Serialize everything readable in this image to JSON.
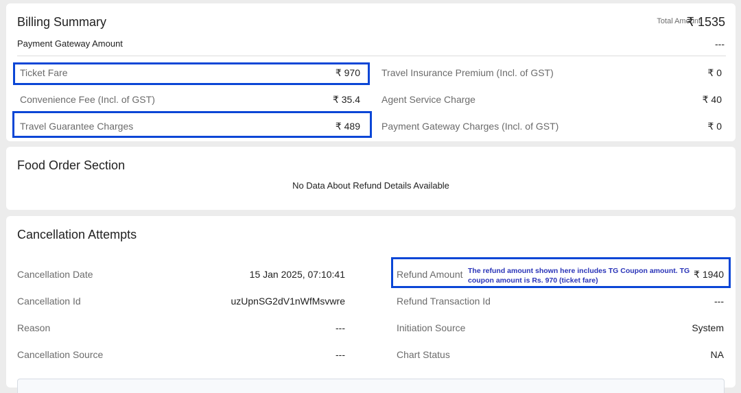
{
  "billing": {
    "title": "Billing Summary",
    "total_label": "Total Amount",
    "total_value": "₹ 1535",
    "gateway_label": "Payment Gateway Amount",
    "gateway_value": "---",
    "rows_left": [
      {
        "label": "Ticket Fare",
        "value": "₹ 970"
      },
      {
        "label": "Convenience Fee (Incl. of GST)",
        "value": "₹ 35.4"
      },
      {
        "label": "Travel Guarantee Charges",
        "value": "₹ 489"
      }
    ],
    "rows_right": [
      {
        "label": "Travel Insurance Premium (Incl. of GST)",
        "value": "₹ 0"
      },
      {
        "label": "Agent Service Charge",
        "value": "₹ 40"
      },
      {
        "label": "Payment Gateway Charges (Incl. of GST)",
        "value": "₹ 0"
      }
    ]
  },
  "food": {
    "title": "Food Order Section",
    "empty_message": "No Data About Refund Details Available"
  },
  "cancellation": {
    "title": "Cancellation Attempts",
    "rows_left": [
      {
        "label": "Cancellation Date",
        "value": "15 Jan 2025, 07:10:41"
      },
      {
        "label": "Cancellation Id",
        "value": "uzUpnSG2dV1nWfMsvwre"
      },
      {
        "label": "Reason",
        "value": "---"
      },
      {
        "label": "Cancellation Source",
        "value": "---"
      }
    ],
    "rows_right": [
      {
        "label": "Refund Amount",
        "value": "₹ 1940"
      },
      {
        "label": "Refund Transaction Id",
        "value": "---"
      },
      {
        "label": "Initiation Source",
        "value": "System"
      },
      {
        "label": "Chart Status",
        "value": "NA"
      }
    ],
    "refund_note": "The refund amount shown here includes TG Coupon amount. TG coupon amount is Rs. 970 (ticket fare)"
  },
  "colors": {
    "highlight": "#0a46d6",
    "note_text": "#2a34b8"
  }
}
